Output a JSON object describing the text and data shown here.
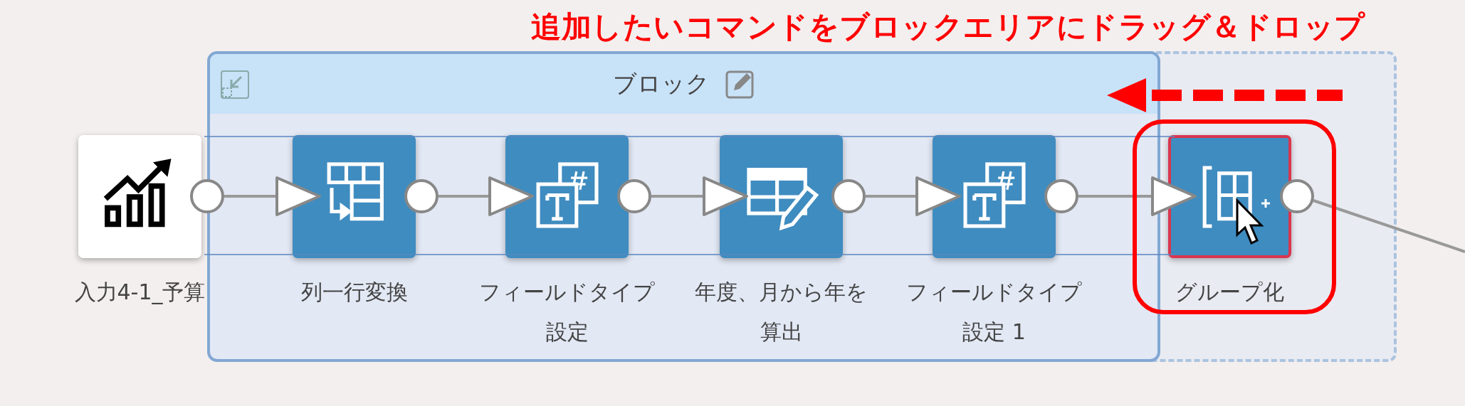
{
  "annotation": "追加したいコマンドをブロックエリアにドラッグ＆ドロップ",
  "block": {
    "title": "ブロック"
  },
  "nodes": [
    {
      "label": "入力4-1_予算",
      "kind": "input",
      "selected": false
    },
    {
      "label": "列一行変換",
      "kind": "pivot",
      "selected": false
    },
    {
      "label": "フィールドタイプ設定",
      "kind": "fieldtype",
      "selected": false
    },
    {
      "label": "年度、月から年を算出",
      "kind": "formula",
      "selected": false
    },
    {
      "label": "フィールドタイプ設定 1",
      "kind": "fieldtype",
      "selected": false
    },
    {
      "label": "グループ化",
      "kind": "group",
      "selected": true
    }
  ]
}
